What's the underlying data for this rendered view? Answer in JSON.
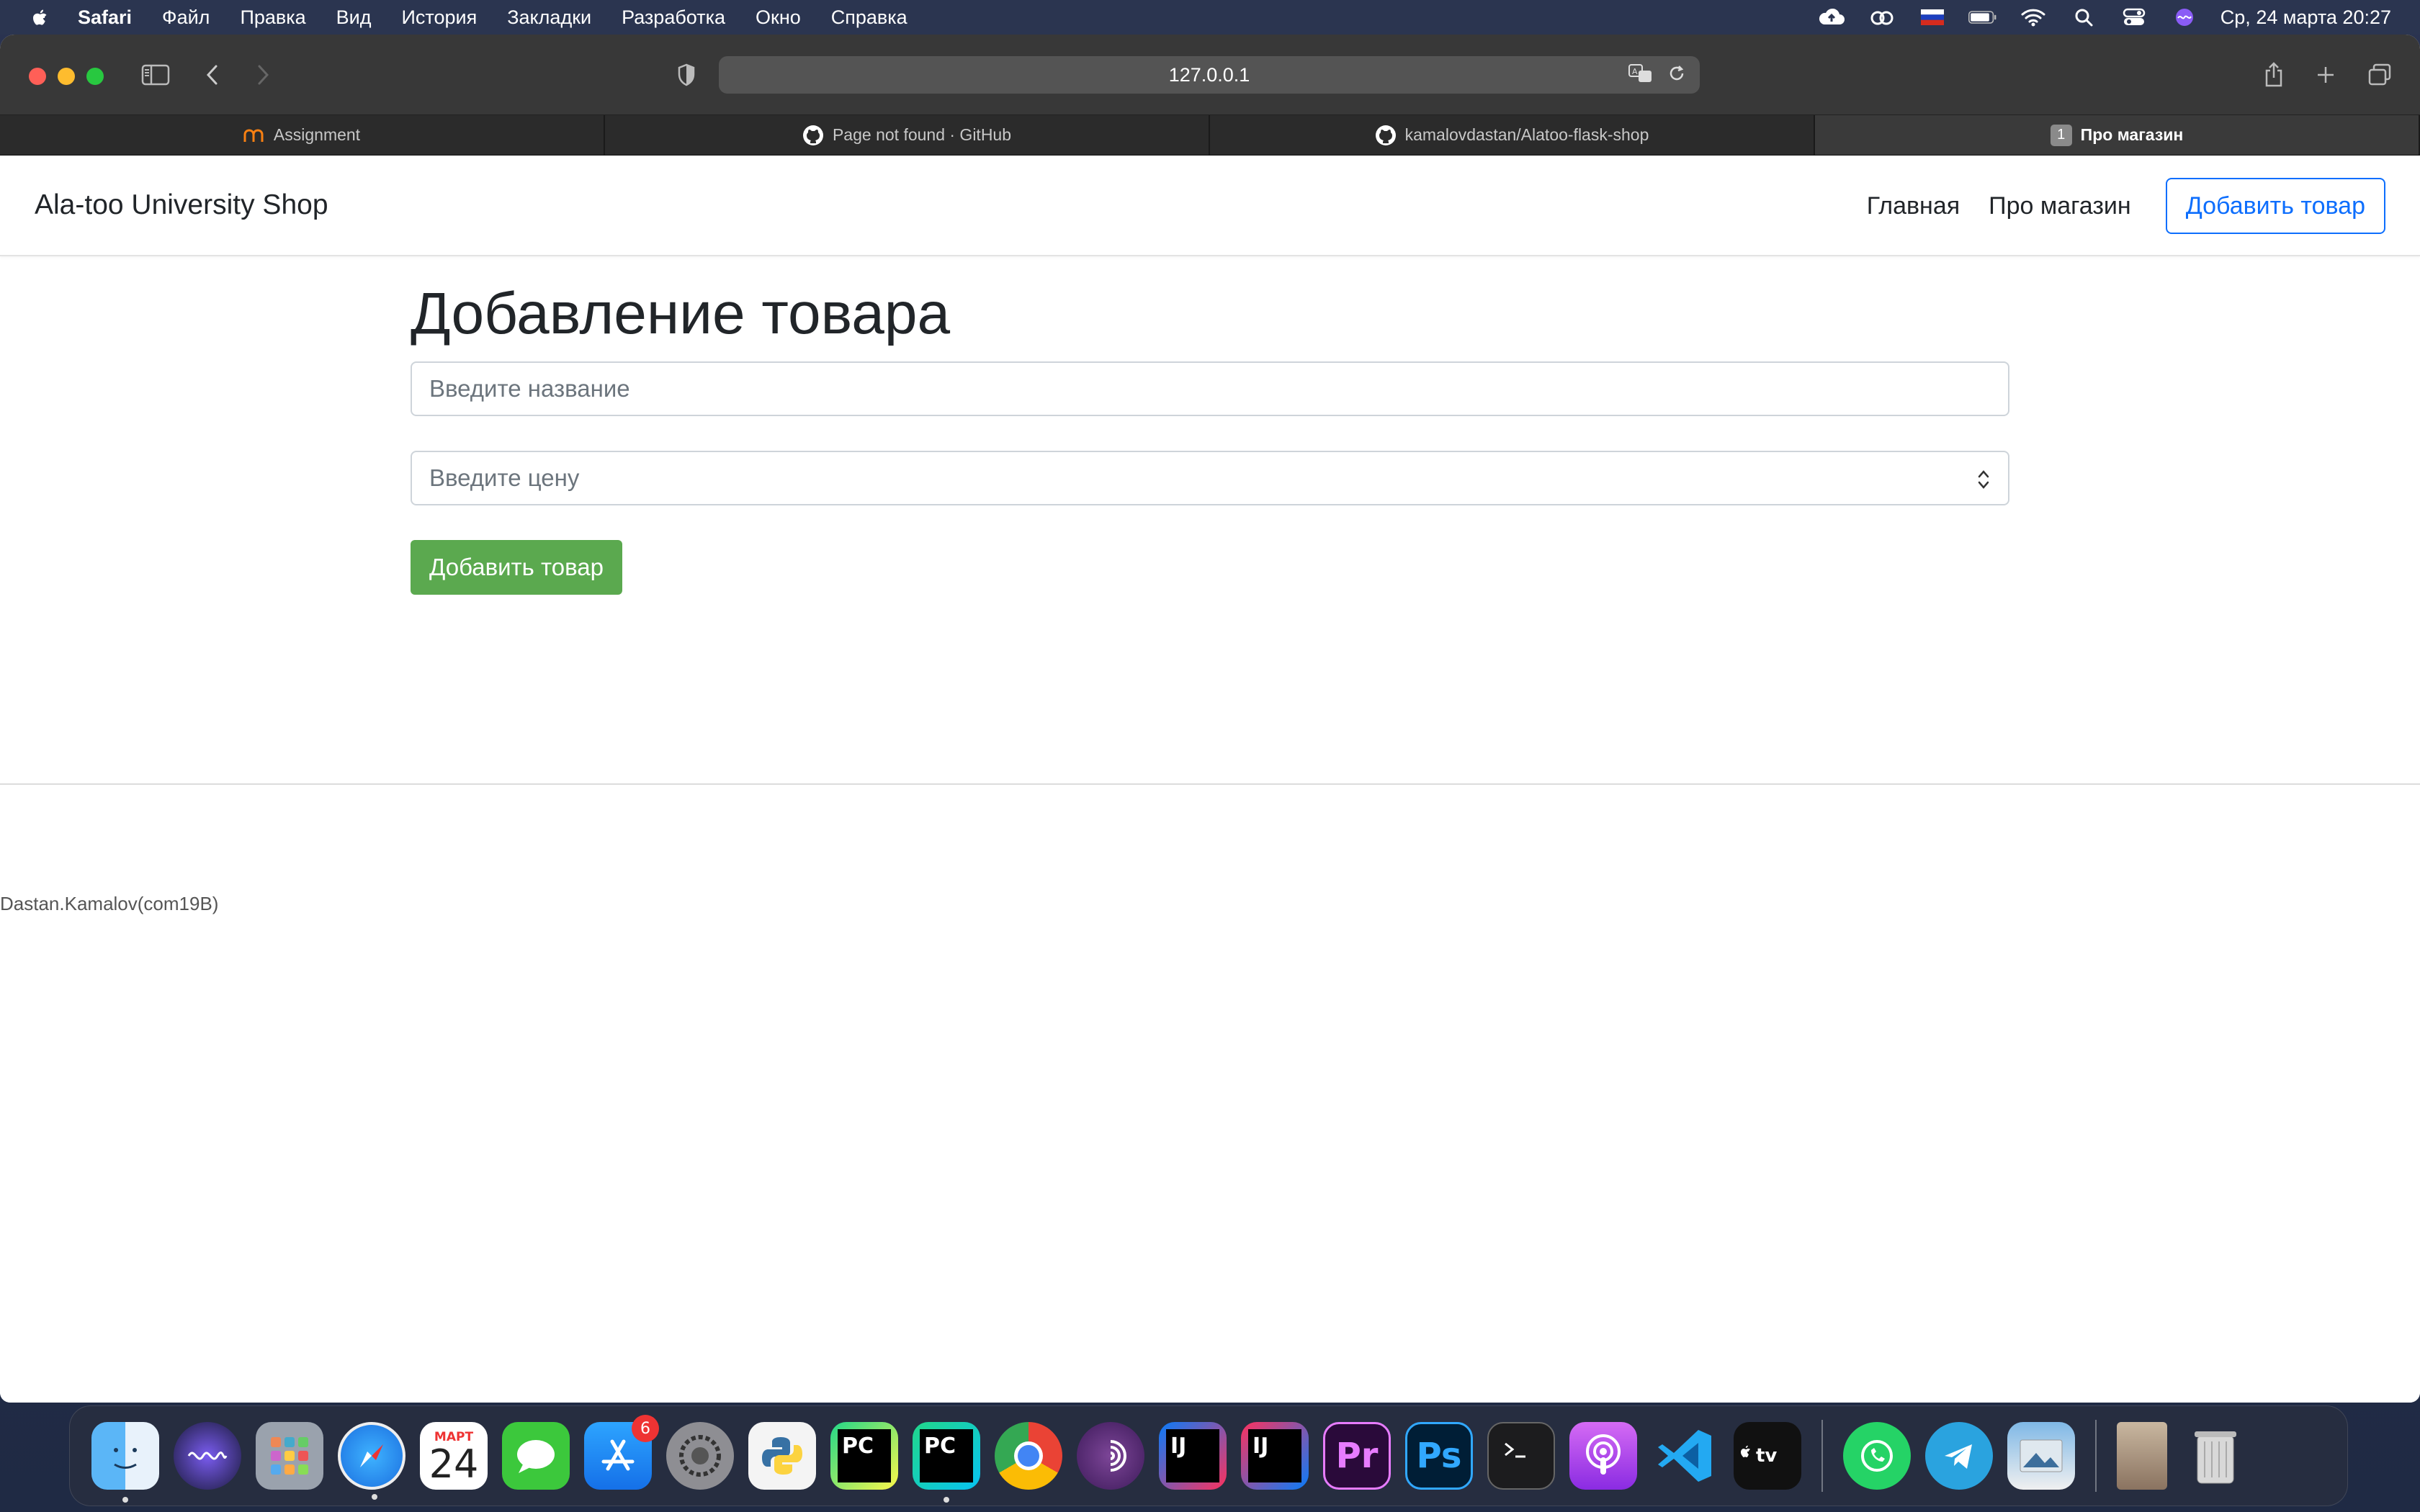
{
  "menubar": {
    "app_name": "Safari",
    "items": [
      "Файл",
      "Правка",
      "Вид",
      "История",
      "Закладки",
      "Разработка",
      "Окно",
      "Справка"
    ],
    "clock": "Ср, 24 марта  20:27",
    "status_icons": [
      "icloud-upload-icon",
      "creative-cloud-icon",
      "russian-flag-icon",
      "battery-icon",
      "wifi-icon",
      "spotlight-search-icon",
      "control-center-icon",
      "siri-icon"
    ]
  },
  "browser": {
    "url": "127.0.0.1",
    "tabs": [
      {
        "label": "Assignment",
        "icon": "moodle-icon",
        "active": false
      },
      {
        "label": "Page not found · GitHub",
        "icon": "github-icon",
        "active": false
      },
      {
        "label": "kamalovdastan/Alatoo-flask-shop",
        "icon": "github-icon",
        "active": false
      },
      {
        "label": "Про магазин",
        "badge": "1",
        "active": true
      }
    ]
  },
  "page": {
    "brand": "Ala-too University Shop",
    "nav": {
      "home": "Главная",
      "about": "Про магазин",
      "add_product": "Добавить товар"
    },
    "heading": "Добавление товара",
    "form": {
      "name_placeholder": "Введите название",
      "price_placeholder": "Введите цену",
      "submit_label": "Добавить товар"
    },
    "footer": "Dastan.Kamalov(com19B)"
  },
  "dock": {
    "calendar_month": "МАРТ",
    "calendar_day": "24",
    "app_store_badge": "6",
    "items": [
      "finder",
      "siri",
      "launchpad",
      "safari",
      "calendar",
      "messages",
      "app-store",
      "system-preferences",
      "python-launcher",
      "pycharm-ce",
      "pycharm",
      "chrome",
      "tor-browser",
      "intellij-ce",
      "intellij",
      "premiere-pro",
      "photoshop",
      "terminal",
      "podcasts",
      "vscode",
      "apple-tv",
      "whatsapp",
      "telegram",
      "preview",
      "downloads-stack",
      "trash"
    ]
  },
  "colors": {
    "accent_blue": "#0d6efd",
    "submit_green": "#5ba94f"
  }
}
